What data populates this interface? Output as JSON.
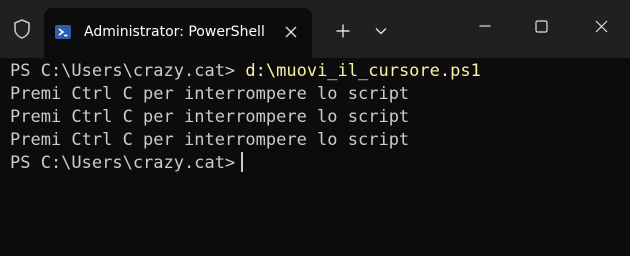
{
  "titlebar": {
    "tab_title": "Administrator: PowerShell",
    "icons": {
      "shield": "shield-icon",
      "powershell": "powershell-icon",
      "tab_close": "close-icon",
      "new_tab": "plus-icon",
      "dropdown": "chevron-down-icon",
      "minimize": "minimize-icon",
      "maximize": "maximize-icon",
      "close": "close-icon"
    }
  },
  "terminal": {
    "prompt": "PS C:\\Users\\crazy.cat>",
    "command": "d:\\muovi_il_cursore.ps1",
    "output": [
      "Premi Ctrl C per interrompere lo script",
      "Premi Ctrl C per interrompere lo script",
      "Premi Ctrl C per interrompere lo script"
    ],
    "prompt_current": "PS C:\\Users\\crazy.cat>"
  },
  "colors": {
    "background": "#0c0c0c",
    "titlebar": "#202020",
    "text": "#cccccc",
    "command": "#f9f1a5"
  }
}
